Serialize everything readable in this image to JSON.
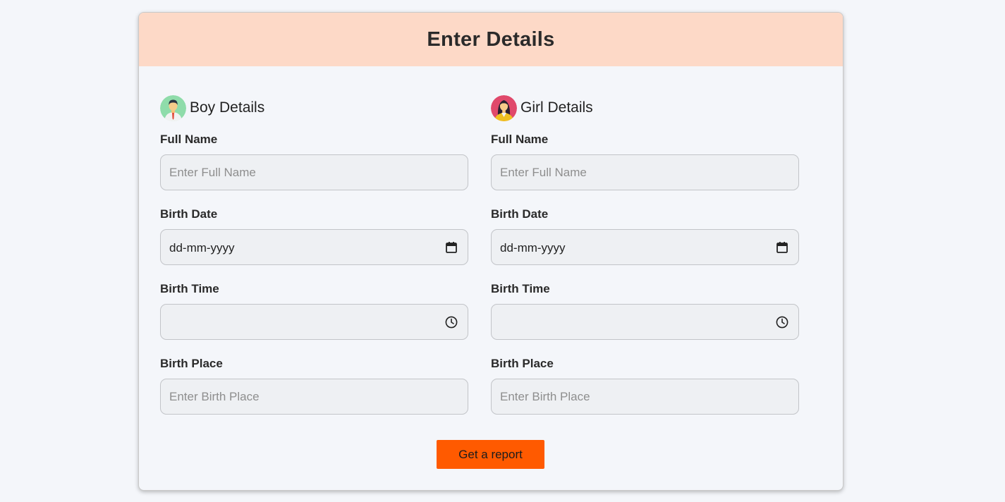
{
  "header": {
    "title": "Enter Details"
  },
  "boy": {
    "title": "Boy Details",
    "avatar_icon": "boy-avatar-icon",
    "full_name": {
      "label": "Full Name",
      "placeholder": "Enter Full Name"
    },
    "birth_date": {
      "label": "Birth Date",
      "value": "dd-mm-yyyy",
      "icon": "calendar-icon"
    },
    "birth_time": {
      "label": "Birth Time",
      "icon": "clock-icon"
    },
    "birth_place": {
      "label": "Birth Place",
      "placeholder": "Enter Birth Place"
    }
  },
  "girl": {
    "title": "Girl Details",
    "avatar_icon": "girl-avatar-icon",
    "full_name": {
      "label": "Full Name",
      "placeholder": "Enter Full Name"
    },
    "birth_date": {
      "label": "Birth Date",
      "value": "dd-mm-yyyy",
      "icon": "calendar-icon"
    },
    "birth_time": {
      "label": "Birth Time",
      "icon": "clock-icon"
    },
    "birth_place": {
      "label": "Birth Place",
      "placeholder": "Enter Birth Place"
    }
  },
  "submit": {
    "label": "Get a report"
  },
  "colors": {
    "header_bg": "#fdd9c7",
    "accent": "#ff5a00",
    "page_bg": "#f4f6fa",
    "input_bg": "#eef0f3"
  }
}
